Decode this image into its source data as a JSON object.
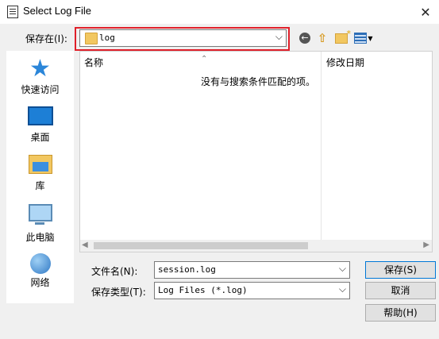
{
  "window": {
    "title": "Select Log File",
    "close_glyph": "✕"
  },
  "lookin": {
    "label": "保存在(I):",
    "value": "log"
  },
  "toolbar": {
    "back": "back-icon",
    "up": "up-folder-icon",
    "new_folder": "new-folder-icon",
    "view": "view-menu-icon"
  },
  "places": [
    {
      "label": "快速访问",
      "icon": "quick-access-star-icon"
    },
    {
      "label": "桌面",
      "icon": "desktop-icon"
    },
    {
      "label": "库",
      "icon": "library-icon"
    },
    {
      "label": "此电脑",
      "icon": "this-pc-icon"
    },
    {
      "label": "网络",
      "icon": "network-icon"
    }
  ],
  "filelist": {
    "columns": [
      "名称",
      "修改日期"
    ],
    "empty_message": "没有与搜索条件匹配的项。"
  },
  "filename": {
    "label": "文件名(N):",
    "value": "session.log"
  },
  "filetype": {
    "label": "保存类型(T):",
    "value": "Log Files (*.log)"
  },
  "buttons": {
    "save": "保存(S)",
    "cancel": "取消",
    "help": "帮助(H)"
  },
  "colors": {
    "highlight": "#e0202a",
    "accent": "#0078d7"
  }
}
